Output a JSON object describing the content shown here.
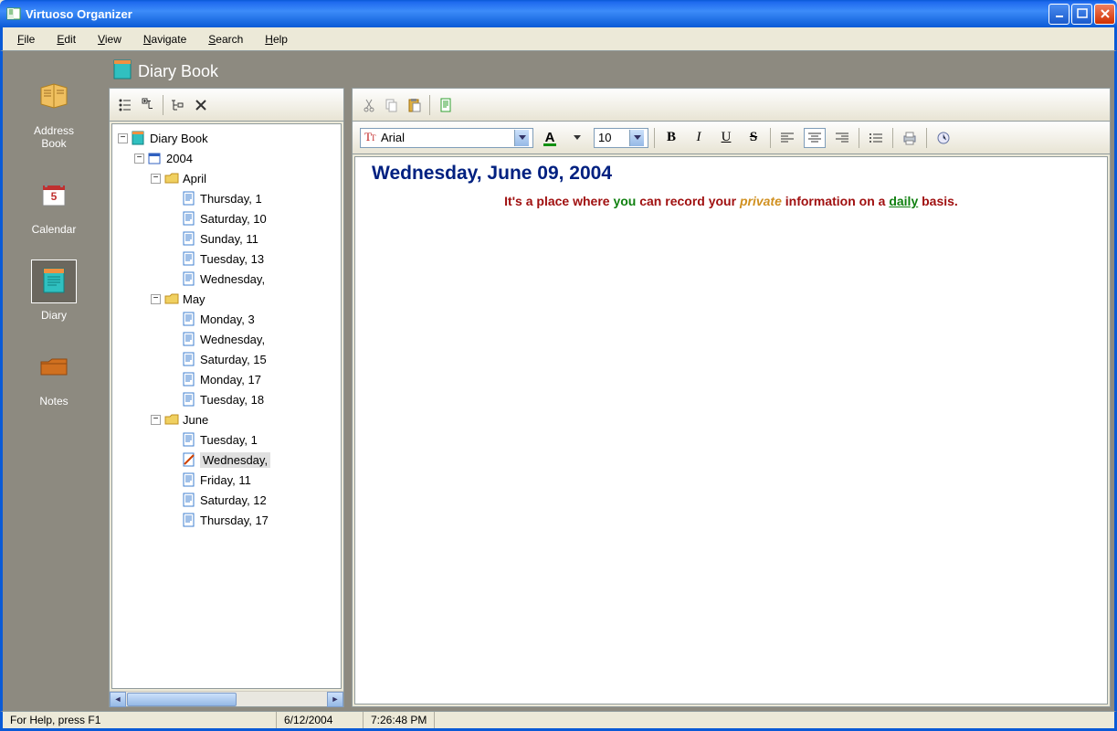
{
  "window": {
    "title": "Virtuoso Organizer"
  },
  "menu": {
    "file": "File",
    "edit": "Edit",
    "view": "View",
    "navigate": "Navigate",
    "search": "Search",
    "help": "Help"
  },
  "sidebar": {
    "items": [
      {
        "label": "Address Book"
      },
      {
        "label": "Calendar"
      },
      {
        "label": "Diary"
      },
      {
        "label": "Notes"
      }
    ]
  },
  "panel": {
    "title": "Diary Book"
  },
  "tree": {
    "root": "Diary Book",
    "year": "2004",
    "april": {
      "label": "April",
      "entries": [
        "Thursday, 1",
        "Saturday, 10",
        "Sunday, 11",
        "Tuesday, 13",
        "Wednesday,"
      ]
    },
    "may": {
      "label": "May",
      "entries": [
        "Monday, 3",
        "Wednesday,",
        "Saturday, 15",
        "Monday, 17",
        "Tuesday, 18"
      ]
    },
    "june": {
      "label": "June",
      "entries": [
        "Tuesday, 1",
        "Wednesday,",
        "Friday, 11",
        "Saturday, 12",
        "Thursday, 17"
      ]
    }
  },
  "editor": {
    "font_name": "Arial",
    "font_size": "10",
    "title": "Wednesday, June 09, 2004",
    "words": {
      "w1": "It's a place where",
      "w2": "you",
      "w3": "can record your",
      "w4": "private",
      "w5": "information on a",
      "w6": "daily",
      "w7": "basis."
    }
  },
  "status": {
    "help": "For Help, press F1",
    "date": "6/12/2004",
    "time": "7:26:48 PM"
  }
}
